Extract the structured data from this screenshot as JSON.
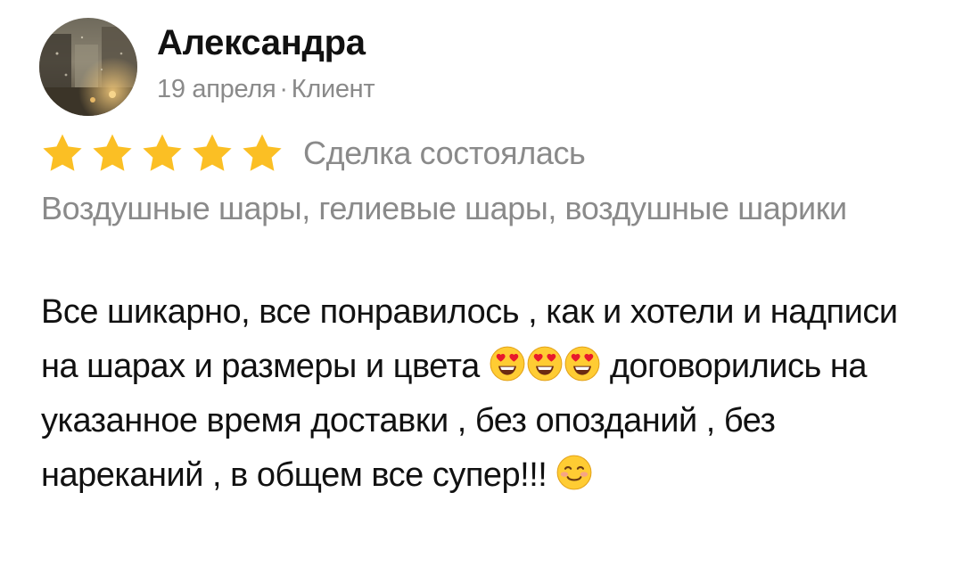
{
  "review": {
    "author": {
      "name": "Александра",
      "date": "19 апреля",
      "separator": "·",
      "role": "Клиент"
    },
    "rating": {
      "stars": 5,
      "max_stars": 5,
      "star_color": "#fbbf24",
      "status": "Сделка состоялась"
    },
    "services": "Воздушные шары, гелиевые шары, воздушные шарики",
    "body": {
      "part1": "Все шикарно, все понравилось , как и хотели и надписи на шарах и размеры и цвета ",
      "emoji_group_1": [
        "heart-eyes-emoji",
        "heart-eyes-emoji",
        "heart-eyes-emoji"
      ],
      "part2": " договорились на указанное время доставки , без опозданий , без нареканий , в общем все супер!!! ",
      "emoji_group_2": [
        "smiling-emoji"
      ]
    }
  },
  "colors": {
    "text_primary": "#111111",
    "text_secondary": "#8a8a8a",
    "emoji_face": "#ffcc33",
    "emoji_heart": "#e8192c"
  }
}
